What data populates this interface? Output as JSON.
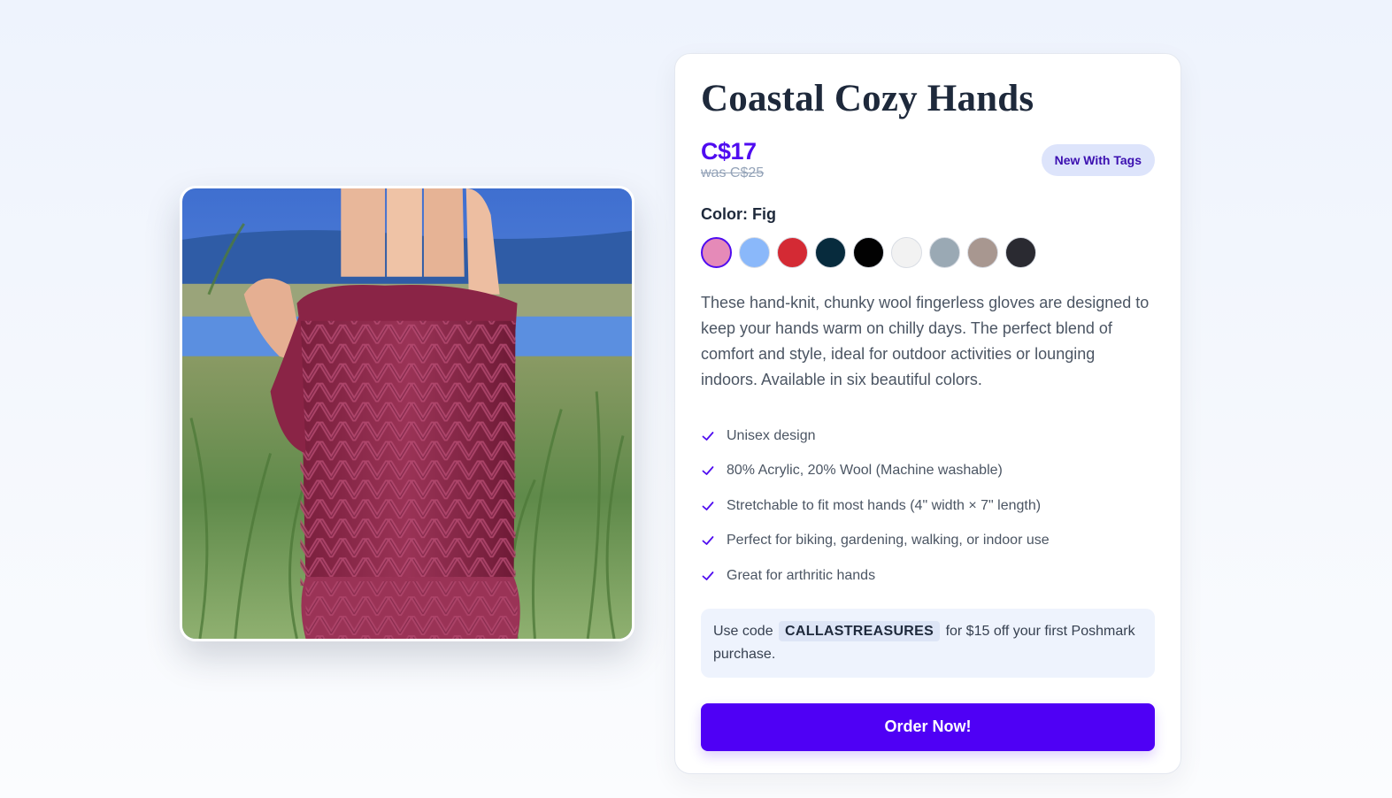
{
  "product": {
    "title": "Coastal Cozy Hands",
    "price": "C$17",
    "old_price": "was C$25",
    "condition_badge": "New With Tags",
    "color_label": "Color: Fig",
    "swatches": [
      {
        "name": "Fig",
        "color": "#e58ab8",
        "selected": true
      },
      {
        "name": "Sky",
        "color": "#8ab8fa",
        "selected": false
      },
      {
        "name": "Red",
        "color": "#d42a34",
        "selected": false
      },
      {
        "name": "Navy",
        "color": "#072b3d",
        "selected": false
      },
      {
        "name": "Black",
        "color": "#020202",
        "selected": false
      },
      {
        "name": "White",
        "color": "#f2f2f2",
        "selected": false
      },
      {
        "name": "Grey",
        "color": "#9aa9b4",
        "selected": false
      },
      {
        "name": "Taupe",
        "color": "#a89790",
        "selected": false
      },
      {
        "name": "Charcoal",
        "color": "#2a2a31",
        "selected": false
      }
    ],
    "description": "These hand-knit, chunky wool fingerless gloves are designed to keep your hands warm on chilly days. The perfect blend of comfort and style, ideal for outdoor activities or lounging indoors. Available in six beautiful colors.",
    "features": [
      "Unisex design",
      "80% Acrylic, 20% Wool (Machine washable)",
      "Stretchable to fit most hands (4\" width × 7\" length)",
      "Perfect for biking, gardening, walking, or indoor use",
      "Great for arthritic hands"
    ]
  },
  "promo": {
    "prefix": "Use code",
    "code": "CALLASTREASURES",
    "suffix": "for $15 off your first Poshmark purchase."
  },
  "cta": {
    "order_label": "Order Now!"
  },
  "colors": {
    "accent": "#4f00f5",
    "price": "#4f0cf0",
    "badge_bg": "#dde4fb"
  },
  "icons": {
    "feature_bullet": "check-icon"
  }
}
